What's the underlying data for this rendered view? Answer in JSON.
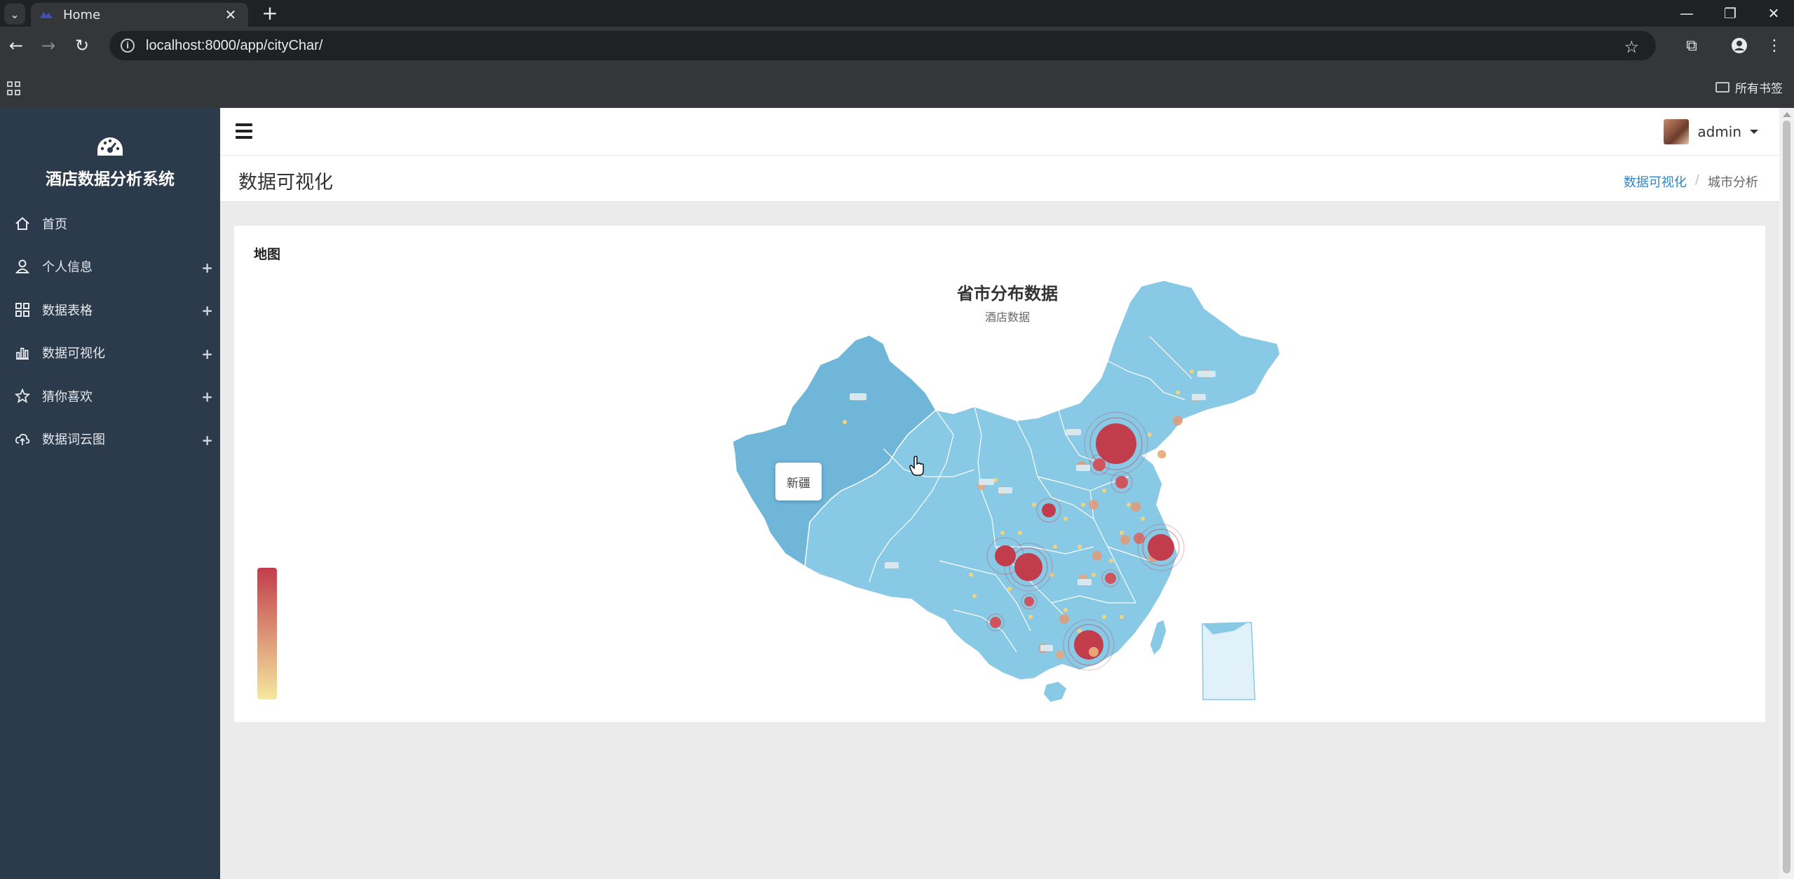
{
  "browser": {
    "tab_title": "Home",
    "url": "localhost:8000/app/cityChar/",
    "bookmarks_label": "所有书签"
  },
  "sidebar": {
    "brand": "酒店数据分析系统",
    "items": [
      {
        "label": "首页",
        "icon": "home-icon",
        "expandable": false
      },
      {
        "label": "个人信息",
        "icon": "user-icon",
        "expandable": true
      },
      {
        "label": "数据表格",
        "icon": "grid-icon",
        "expandable": true
      },
      {
        "label": "数据可视化",
        "icon": "bar-chart-icon",
        "expandable": true
      },
      {
        "label": "猜你喜欢",
        "icon": "star-icon",
        "expandable": true
      },
      {
        "label": "数据词云图",
        "icon": "cloud-icon",
        "expandable": true
      }
    ]
  },
  "header": {
    "user": "admin"
  },
  "page": {
    "title": "数据可视化",
    "breadcrumb": [
      "数据可视化",
      "城市分析"
    ]
  },
  "card": {
    "title": "地图"
  },
  "map": {
    "title": "省市分布数据",
    "subtitle": "酒店数据",
    "tooltip": "新疆",
    "colors": {
      "land": "#88c9e6",
      "high": "#c23d4b",
      "low": "#f5e8a0"
    }
  }
}
